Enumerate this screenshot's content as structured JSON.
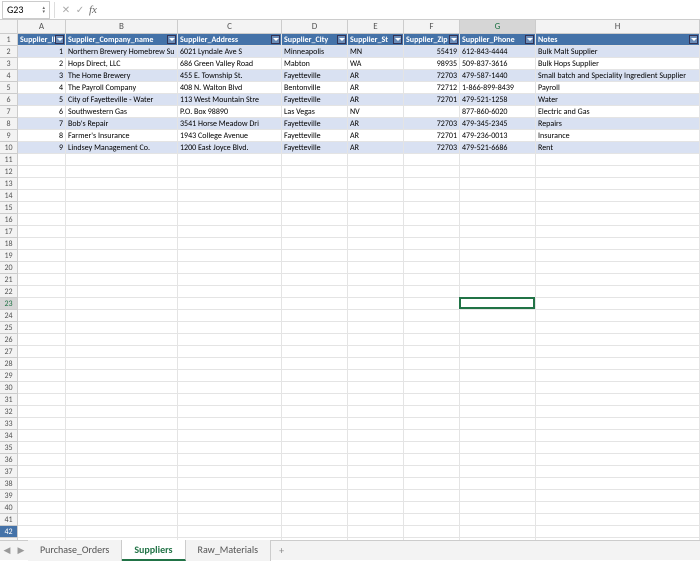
{
  "name_box": "G23",
  "formula": "",
  "columns": [
    {
      "letter": "A",
      "class": "cA"
    },
    {
      "letter": "B",
      "class": "cB"
    },
    {
      "letter": "C",
      "class": "cC"
    },
    {
      "letter": "D",
      "class": "cD"
    },
    {
      "letter": "E",
      "class": "cE"
    },
    {
      "letter": "F",
      "class": "cF"
    },
    {
      "letter": "G",
      "class": "cG"
    },
    {
      "letter": "H",
      "class": "cH"
    }
  ],
  "headers": [
    "Supplier_ID",
    "Supplier_Company_name",
    "Supplier_Address",
    "Supplier_City",
    "Supplier_St",
    "Supplier_Zip",
    "Supplier_Phone",
    "Notes"
  ],
  "data_rows": [
    {
      "id": 1,
      "company": "Northern Brewery Homebrew Su",
      "address": "6021 Lyndale Ave S",
      "city": "Minneapolis",
      "st": "MN",
      "zip": 55419,
      "phone": "612-843-4444",
      "notes": "Bulk Malt Supplier"
    },
    {
      "id": 2,
      "company": "Hops Direct, LLC",
      "address": "686 Green Valley Road",
      "city": "Mabton",
      "st": "WA",
      "zip": 98935,
      "phone": "509-837-3616",
      "notes": "Bulk Hops Supplier"
    },
    {
      "id": 3,
      "company": "The Home Brewery",
      "address": "455 E. Township St.",
      "city": "Fayetteville",
      "st": "AR",
      "zip": 72703,
      "phone": "479-587-1440",
      "notes": "Small batch and Speciality Ingredient Supplier"
    },
    {
      "id": 4,
      "company": "The Payroll Company",
      "address": "408 N. Walton Blvd",
      "city": "Bentonville",
      "st": "AR",
      "zip": 72712,
      "phone": "1-866-899-8439",
      "notes": "Payroll"
    },
    {
      "id": 5,
      "company": "City of Fayetteville - Water",
      "address": "113 West Mountain Stre",
      "city": "Fayetteville",
      "st": "AR",
      "zip": 72701,
      "phone": "479-521-1258",
      "notes": "Water"
    },
    {
      "id": 6,
      "company": "Southwestern Gas",
      "address": "P.O. Box 98890",
      "city": "Las Vegas",
      "st": "NV",
      "zip": "",
      "phone": "877-860-6020",
      "notes": "Electric and Gas"
    },
    {
      "id": 7,
      "company": "Bob's Repair",
      "address": "3541 Horse Meadow Dri",
      "city": "Fayetteville",
      "st": "AR",
      "zip": 72703,
      "phone": "479-345-2345",
      "notes": "Repairs"
    },
    {
      "id": 8,
      "company": "Farmer's Insurance",
      "address": "1943 College Avenue",
      "city": "Fayetteville",
      "st": "AR",
      "zip": 72701,
      "phone": "479-236-0013",
      "notes": "Insurance"
    },
    {
      "id": 9,
      "company": "Lindsey Management Co.",
      "address": "1200 East Joyce Blvd.",
      "city": "Fayetteville",
      "st": "AR",
      "zip": 72703,
      "phone": "479-521-6686",
      "notes": "Rent"
    }
  ],
  "total_rows": 43,
  "row_42_marked": true,
  "active": {
    "row": 23,
    "col": "G",
    "col_index": 6
  },
  "tabs": [
    {
      "label": "Purchase_Orders",
      "active": false
    },
    {
      "label": "Suppliers",
      "active": true
    },
    {
      "label": "Raw_Materials",
      "active": false
    }
  ],
  "icons": {
    "cancel": "✕",
    "confirm": "✓",
    "fx": "fx",
    "nav_left": "◀",
    "nav_right": "▶",
    "add": "+"
  }
}
